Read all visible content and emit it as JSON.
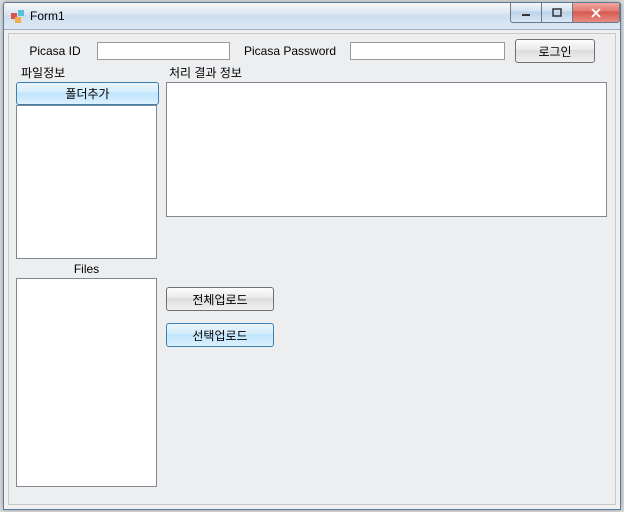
{
  "window": {
    "title": "Form1"
  },
  "credentials": {
    "id_label": "Picasa ID",
    "id_value": "",
    "pw_label": "Picasa Password",
    "pw_value": "",
    "login_button": "로그인"
  },
  "file_section": {
    "group_label": "파일정보",
    "add_folder_button": "폴더추가",
    "files_label": "Files"
  },
  "result_section": {
    "group_label": "처리 결과 정보"
  },
  "upload": {
    "all_button": "전체업로드",
    "selected_button": "선택업로드"
  }
}
